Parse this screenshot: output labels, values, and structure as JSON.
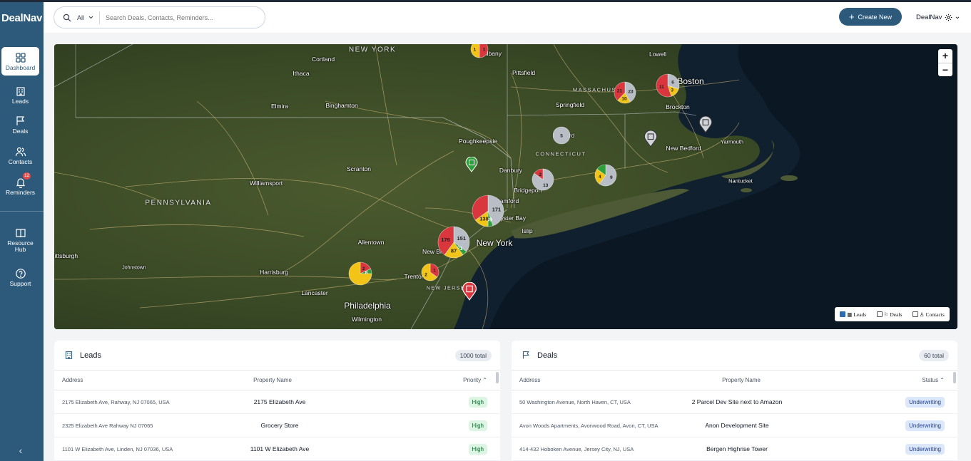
{
  "app": {
    "name": "DealNav"
  },
  "sidebar": {
    "items": [
      {
        "label": "Dashboard"
      },
      {
        "label": "Leads"
      },
      {
        "label": "Deals"
      },
      {
        "label": "Contacts"
      },
      {
        "label": "Reminders",
        "badge": "12"
      },
      {
        "label": "Resource Hub"
      },
      {
        "label": "Support"
      }
    ],
    "collapse": "‹"
  },
  "topbar": {
    "search_scope": "All",
    "search_placeholder": "Search Deals, Contacts, Reminders...",
    "create_label": "Create New",
    "org_name": "DealNav"
  },
  "map": {
    "states": [
      "NEW YORK",
      "PENNSYLVANIA",
      "MASSACHUSETTS",
      "CONNECTICUT",
      "NEW JERSEY"
    ],
    "cities": [
      "Cortland",
      "Ithaca",
      "Elmira",
      "Binghamton",
      "Albany",
      "Pittsfield",
      "Springfield",
      "Lowell",
      "Boston",
      "Brockton",
      "Hartford",
      "New Bedford",
      "Yarmouth",
      "Nantucket",
      "Poughkeepsie",
      "Danbury",
      "Bridgeport",
      "Stamford",
      "Oyster Bay",
      "Islip",
      "New York",
      "Scranton",
      "Williamsport",
      "Allentown",
      "New Brunswick",
      "Trenton",
      "Harrisburg",
      "Johnstown",
      "Lancaster",
      "Philadelphia",
      "Wilmington",
      "Pittsburgh"
    ],
    "clusters": [
      {
        "id": "albany",
        "values": [
          "1",
          "1"
        ]
      },
      {
        "id": "worcester",
        "values": [
          "23",
          "10",
          "21"
        ]
      },
      {
        "id": "boston",
        "values": [
          "6",
          "3",
          "11"
        ]
      },
      {
        "id": "hartford",
        "values": [
          "5"
        ]
      },
      {
        "id": "new-haven",
        "values": [
          "13",
          "2"
        ]
      },
      {
        "id": "ct-east",
        "values": [
          "9",
          "4"
        ]
      },
      {
        "id": "stamford",
        "values": [
          "171",
          "69",
          "138"
        ]
      },
      {
        "id": "nyc",
        "values": [
          "151",
          "21",
          "87",
          "176"
        ]
      },
      {
        "id": "trenton",
        "values": [
          "1",
          "2"
        ]
      },
      {
        "id": "pa-east",
        "values": [
          "2",
          "8"
        ]
      }
    ],
    "layers": {
      "leads": "Leads",
      "deals": "Deals",
      "contacts": "Contacts"
    },
    "zoom_in": "+",
    "zoom_out": "−",
    "colors": {
      "gray": "#b9bec6",
      "green": "#2e9e3a",
      "yellow": "#f2c418",
      "red": "#d9363e"
    }
  },
  "leads": {
    "title": "Leads",
    "total": "1000 total",
    "columns": {
      "address": "Address",
      "name": "Property Name",
      "priority": "Priority ⌃"
    },
    "rows": [
      {
        "address": "2175 Elizabeth Ave, Rahway, NJ 07065, USA",
        "name": "2175 Elizabeth Ave",
        "priority": "High"
      },
      {
        "address": "2325 Elizabeth Ave Rahway NJ 07065",
        "name": "Grocery Store",
        "priority": "High"
      },
      {
        "address": "1101 W Elizabeth Ave, Linden, NJ 07036, USA",
        "name": "1101 W Elizabeth Ave",
        "priority": "High"
      }
    ]
  },
  "deals": {
    "title": "Deals",
    "total": "60 total",
    "columns": {
      "address": "Address",
      "name": "Property Name",
      "status": "Status ⌃"
    },
    "rows": [
      {
        "address": "50 Washington Avenue, North Haven, CT, USA",
        "name": "2 Parcel Dev Site next to Amazon",
        "status": "Underwriting"
      },
      {
        "address": "Avon Woods Apartments, Avonwood Road, Avon, CT, USA",
        "name": "Anon Development Site",
        "status": "Underwriting"
      },
      {
        "address": "414-432 Hoboken Avenue, Jersey City, NJ, USA",
        "name": "Bergen Highrise Tower",
        "status": "Underwriting"
      }
    ]
  }
}
